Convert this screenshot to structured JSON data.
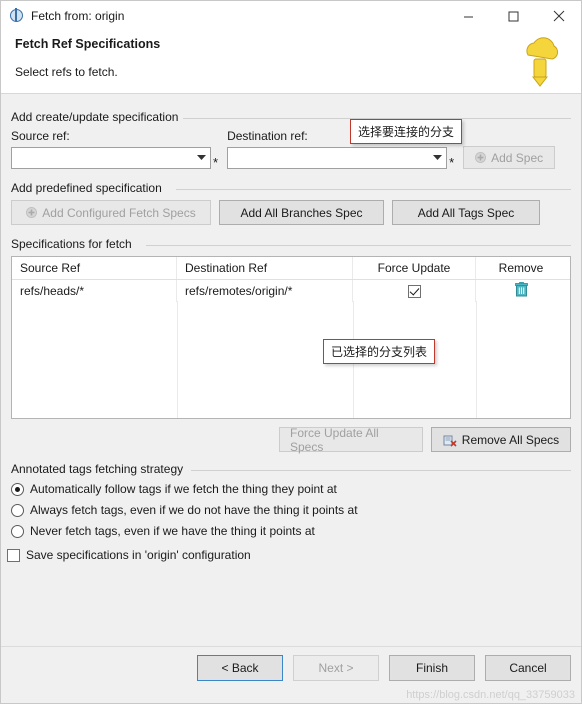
{
  "window": {
    "title": "Fetch from: origin",
    "icon": "globe-icon",
    "minimize": "minimize-icon",
    "maximize": "maximize-icon",
    "close": "close-icon"
  },
  "header": {
    "title": "Fetch Ref Specifications",
    "subtitle": "Select refs to fetch.",
    "icon": "cloud-download-icon"
  },
  "create_update": {
    "group_label": "Add create/update specification",
    "source_label": "Source ref:",
    "destination_label": "Destination ref:",
    "source_value": "",
    "destination_value": "",
    "add_spec_label": "Add Spec",
    "add_spec_icon": "add-icon"
  },
  "predefined": {
    "group_label": "Add predefined specification",
    "configured_label": "Add Configured Fetch Specs",
    "configured_icon": "add-icon",
    "all_branches_label": "Add All Branches Spec",
    "all_tags_label": "Add All Tags Spec"
  },
  "specs": {
    "group_label": "Specifications for fetch",
    "columns": [
      "Source Ref",
      "Destination Ref",
      "Force Update",
      "Remove"
    ],
    "rows": [
      {
        "source": "refs/heads/*",
        "destination": "refs/remotes/origin/*",
        "force_update": true,
        "remove_icon": "trash-icon"
      }
    ],
    "force_update_all_label": "Force Update All Specs",
    "remove_all_label": "Remove All Specs",
    "remove_all_icon": "remove-all-icon"
  },
  "tags_strategy": {
    "group_label": "Annotated tags fetching strategy",
    "options": [
      {
        "label": "Automatically follow tags if we fetch the thing they point at",
        "selected": true
      },
      {
        "label": "Always fetch tags, even if we do not have the thing it points at",
        "selected": false
      },
      {
        "label": "Never fetch tags, even if we have the thing it points at",
        "selected": false
      }
    ]
  },
  "save_spec": {
    "label": "Save specifications in 'origin' configuration",
    "checked": false
  },
  "annotations": [
    {
      "text": "选择要连接的分支"
    },
    {
      "text": "已选择的分支列表"
    }
  ],
  "footer": {
    "back_label": "< Back",
    "next_label": "Next >",
    "finish_label": "Finish",
    "cancel_label": "Cancel",
    "watermark": "https://blog.csdn.net/qq_33759033"
  }
}
